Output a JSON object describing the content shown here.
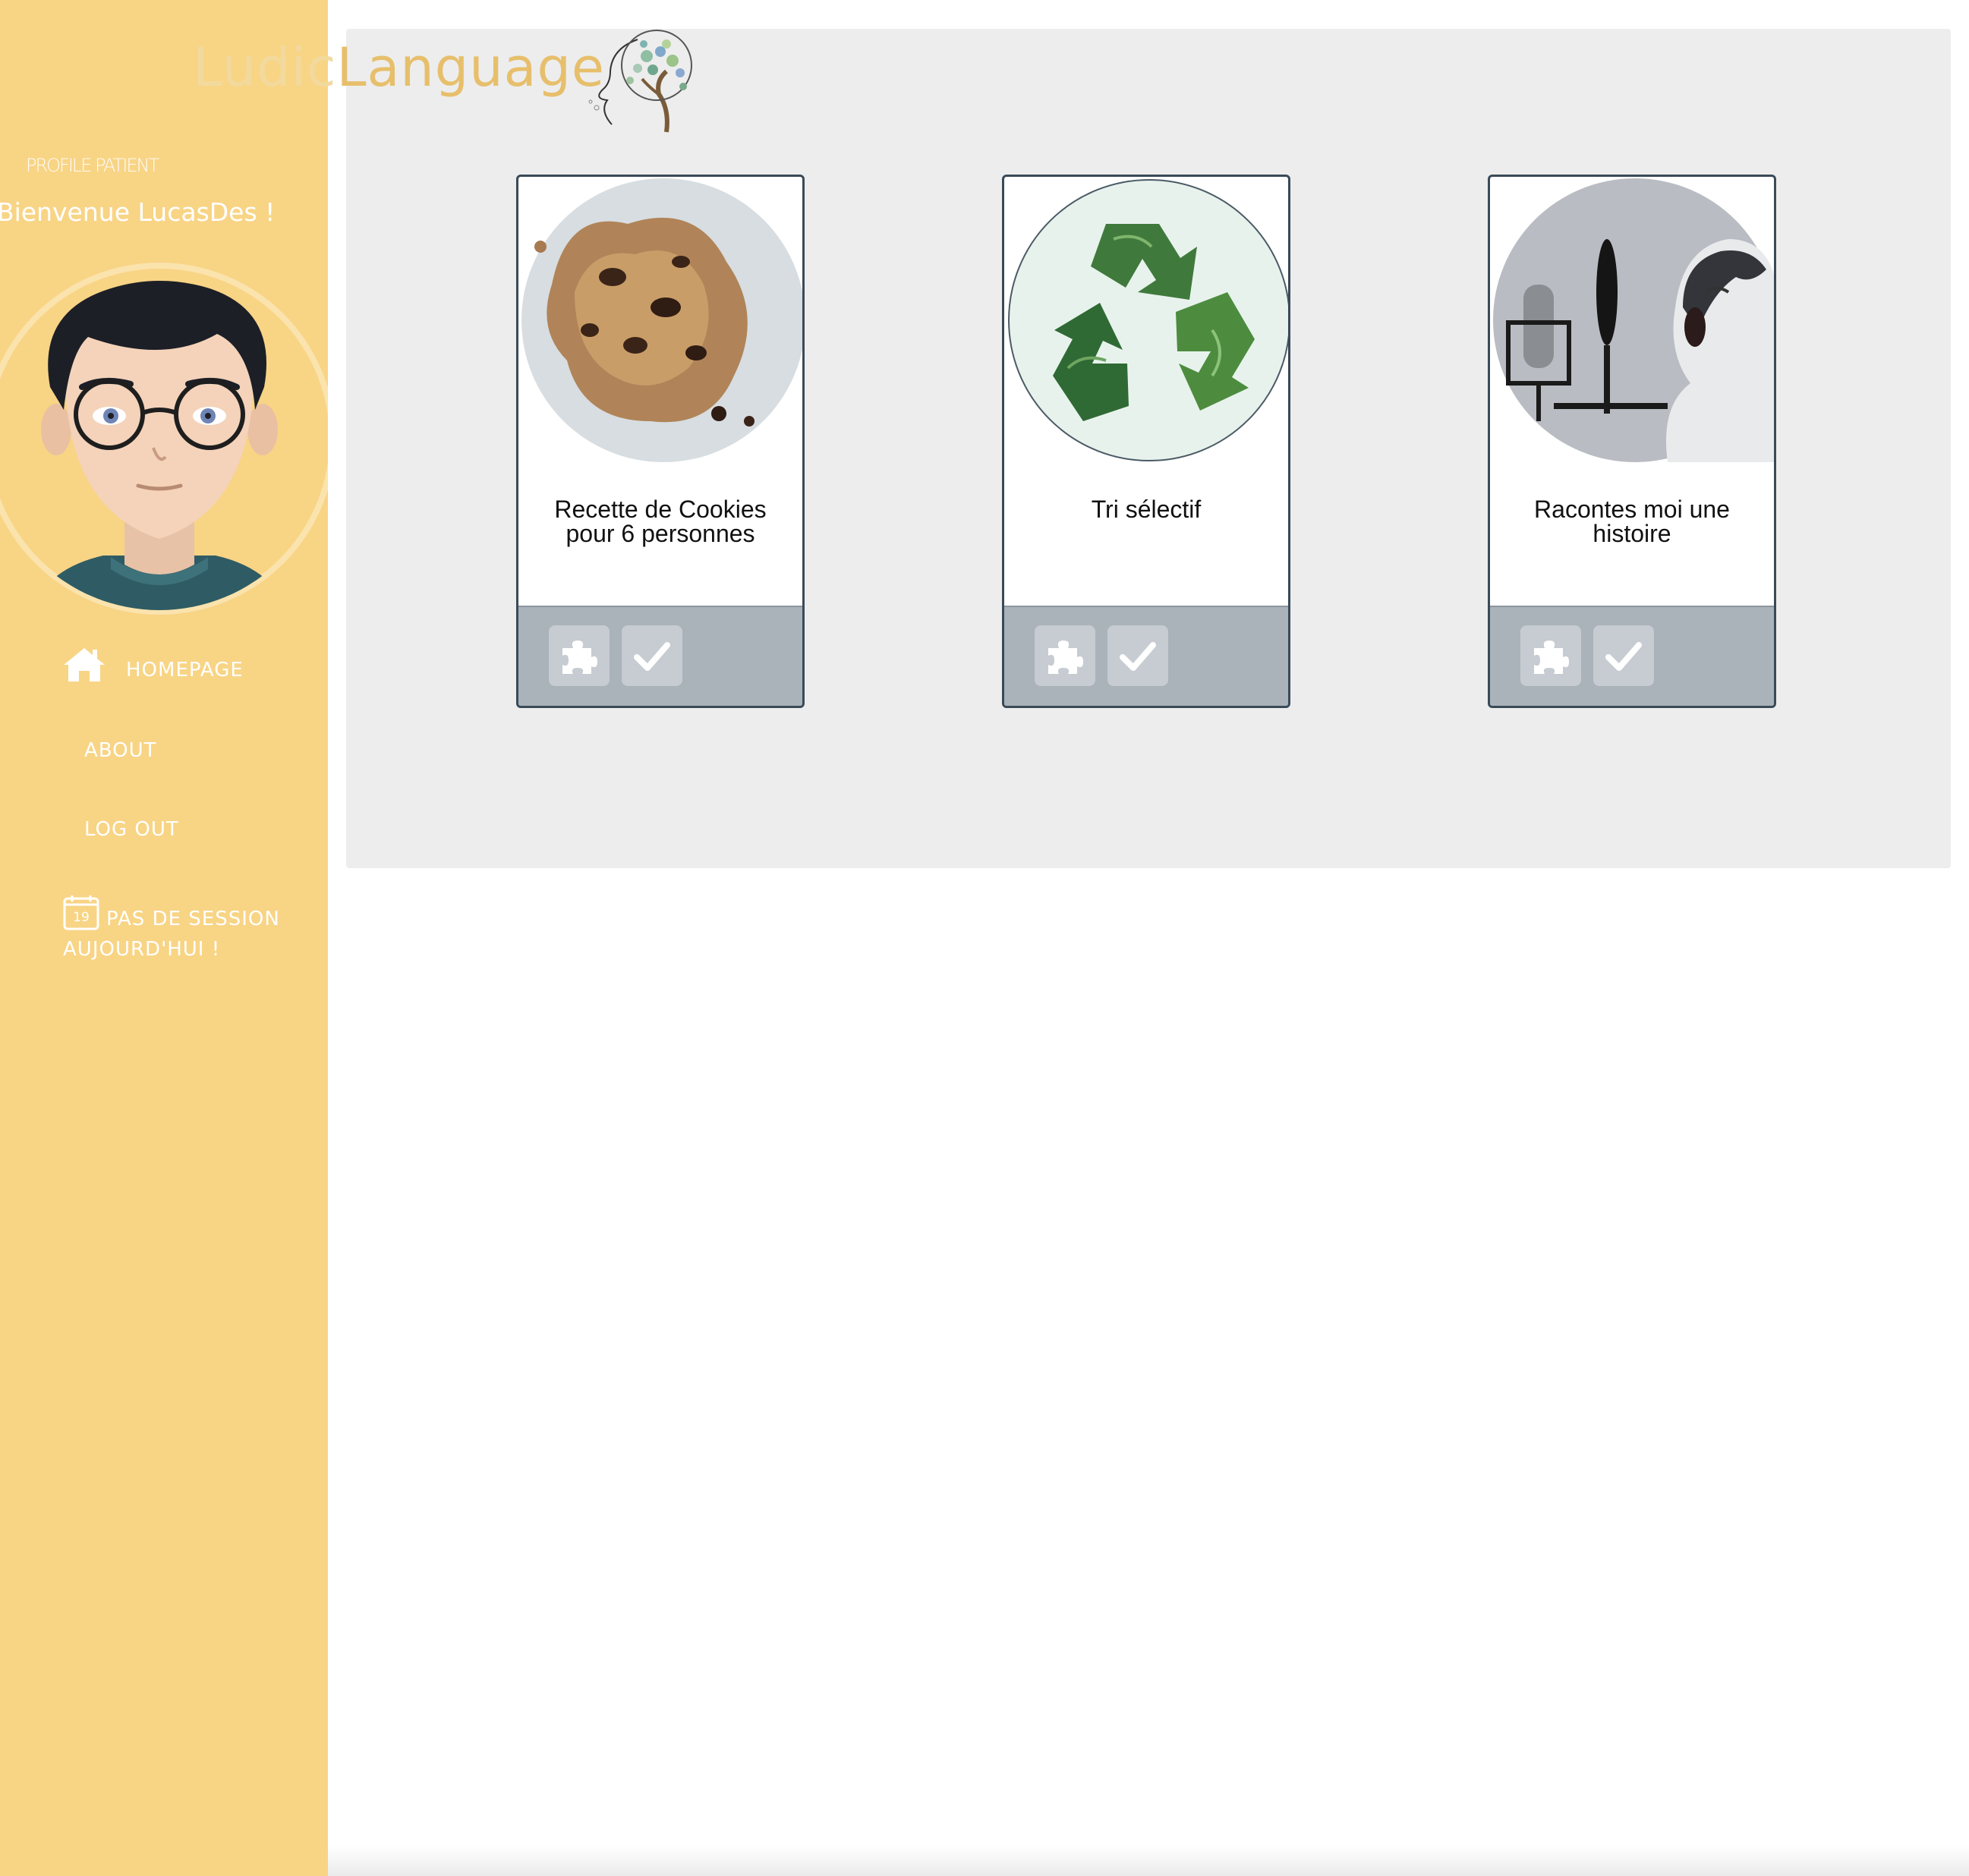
{
  "brand": {
    "part1": "Ludic",
    "part2": "Language"
  },
  "sidebar": {
    "profile_label": "PROFILE PATIENT",
    "welcome": "Bienvenue LucasDes !",
    "nav": {
      "home": "HOMEPAGE",
      "about": "ABOUT",
      "logout": "LOG OUT"
    },
    "calendar_day": "19",
    "session_line1": "PAS DE SESSION",
    "session_line2": "AUJOURD'HUI !"
  },
  "cards": [
    {
      "title": "Recette de Cookies pour 6 personnes",
      "image": "cookie-photo"
    },
    {
      "title": "Tri sélectif",
      "image": "recycle-leaves-photo"
    },
    {
      "title": "Racontes moi une histoire",
      "image": "boy-microphone-photo"
    }
  ],
  "colors": {
    "sidebar": "#f8d485",
    "panel": "#ededed",
    "card_border": "#3a4a57",
    "card_footer": "#aab2ba",
    "logo_light": "#f2da9e",
    "logo_dark": "#e7bf6c"
  }
}
